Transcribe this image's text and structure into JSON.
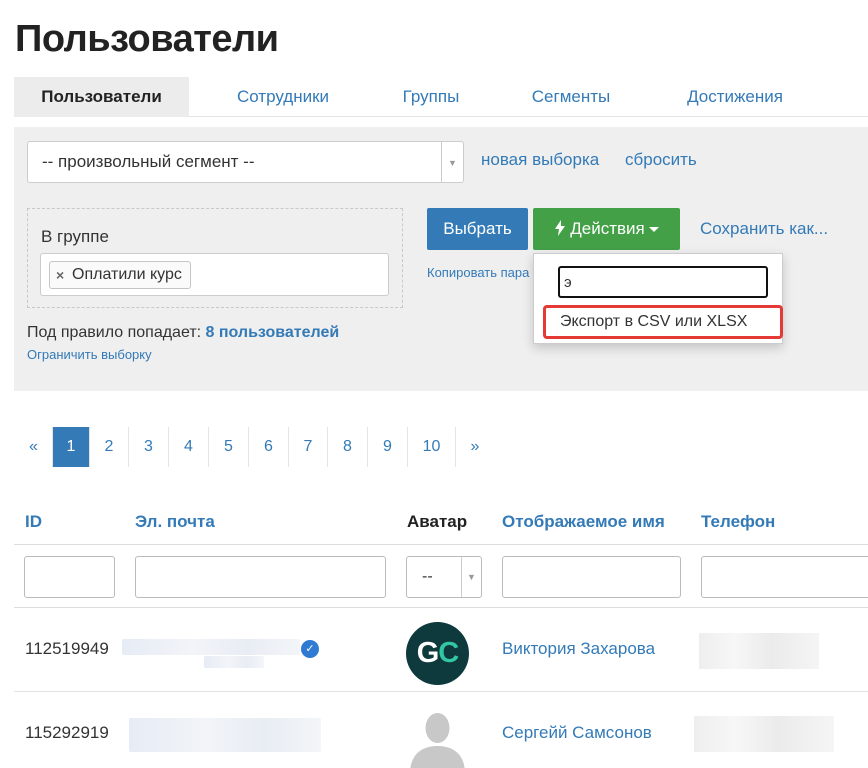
{
  "page": {
    "title": "Пользователи"
  },
  "tabs": [
    {
      "label": "Пользователи",
      "active": true
    },
    {
      "label": "Сотрудники",
      "active": false
    },
    {
      "label": "Группы",
      "active": false
    },
    {
      "label": "Сегменты",
      "active": false
    },
    {
      "label": "Достижения",
      "active": false
    }
  ],
  "filter": {
    "segment_value": "-- произвольный сегмент --",
    "new_selection_label": "новая выборка",
    "reset_label": "сбросить",
    "rule_label": "В группе",
    "rule_tag": "Оплатили курс",
    "rule_tag_remove": "×",
    "rule_count_prefix": "Под правило попадает:",
    "rule_count_value": "8 пользователей",
    "limit_label": "Ограничить выборку",
    "select_button": "Выбрать",
    "actions_button": "Действия",
    "save_as_label": "Сохранить как...",
    "copy_params_label": "Копировать пара"
  },
  "actions_dropdown": {
    "search_value": "э",
    "items": [
      {
        "label": "Экспорт в CSV или XLSX",
        "highlighted": true
      }
    ]
  },
  "pagination": {
    "prev": "«",
    "next": "»",
    "pages": [
      "1",
      "2",
      "3",
      "4",
      "5",
      "6",
      "7",
      "8",
      "9",
      "10"
    ],
    "current": "1"
  },
  "table": {
    "columns": [
      "ID",
      "Эл. почта",
      "Аватар",
      "Отображаемое имя",
      "Телефон"
    ],
    "avatar_filter_value": "--",
    "rows": [
      {
        "id": "112519949",
        "name": "Виктория Захарова",
        "avatar": "GC",
        "verified": true
      },
      {
        "id": "115292919",
        "name": "Сергейй Самсонов",
        "avatar": "default",
        "verified": false
      }
    ]
  },
  "colors": {
    "link": "#337ab7",
    "primary": "#337ab7",
    "success": "#43a047",
    "highlight": "#e53935"
  }
}
